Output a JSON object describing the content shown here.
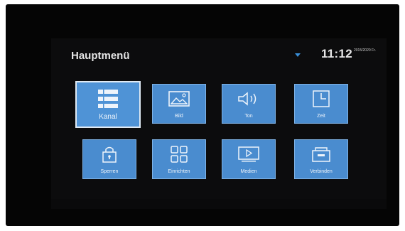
{
  "header": {
    "title": "Hauptmenü",
    "time": "11:12",
    "date": "2015/2020 Fr.",
    "wifi_icon": "wifi-icon"
  },
  "menu": {
    "items": [
      {
        "label": "Kanal",
        "icon": "list-icon",
        "selected": true
      },
      {
        "label": "Bild",
        "icon": "picture-icon",
        "selected": false
      },
      {
        "label": "Ton",
        "icon": "speaker-icon",
        "selected": false
      },
      {
        "label": "Zeit",
        "icon": "clock-icon",
        "selected": false
      },
      {
        "label": "Sperren",
        "icon": "lock-icon",
        "selected": false
      },
      {
        "label": "Einrichten",
        "icon": "grid-icon",
        "selected": false
      },
      {
        "label": "Medien",
        "icon": "media-icon",
        "selected": false
      },
      {
        "label": "Verbinden",
        "icon": "connect-icon",
        "selected": false
      }
    ]
  },
  "colors": {
    "tile": "#4a8ccf",
    "tile_selected": "#4f93d6",
    "accent": "#3a8fd8"
  }
}
